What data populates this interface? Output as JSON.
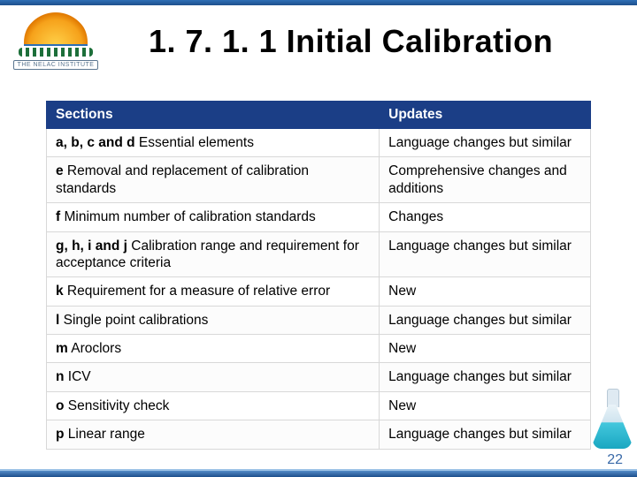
{
  "logo": {
    "label": "THE NELAC INSTITUTE"
  },
  "title": "1. 7. 1. 1 Initial Calibration",
  "table": {
    "headers": {
      "sections": "Sections",
      "updates": "Updates"
    },
    "rows": [
      {
        "lead": "a, b, c and d",
        "rest": " Essential elements",
        "update": "Language changes but similar"
      },
      {
        "lead": "e",
        "rest": " Removal and replacement of calibration standards",
        "update": "Comprehensive changes and additions"
      },
      {
        "lead": "f",
        "rest": " Minimum number of calibration standards",
        "update": "Changes"
      },
      {
        "lead": "g, h, i and j",
        "rest": " Calibration range and requirement for acceptance criteria",
        "update": "Language changes but similar"
      },
      {
        "lead": "k",
        "rest": " Requirement for a measure of relative error",
        "update": "New"
      },
      {
        "lead": "l",
        "rest": " Single point calibrations",
        "update": "Language changes but similar"
      },
      {
        "lead": "m",
        "rest": " Aroclors",
        "update": "New"
      },
      {
        "lead": "n",
        "rest": " ICV",
        "update": "Language changes but similar"
      },
      {
        "lead": "o",
        "rest": " Sensitivity check",
        "update": "New"
      },
      {
        "lead": "p",
        "rest": " Linear range",
        "update": "Language changes but similar"
      }
    ]
  },
  "page_number": "22"
}
